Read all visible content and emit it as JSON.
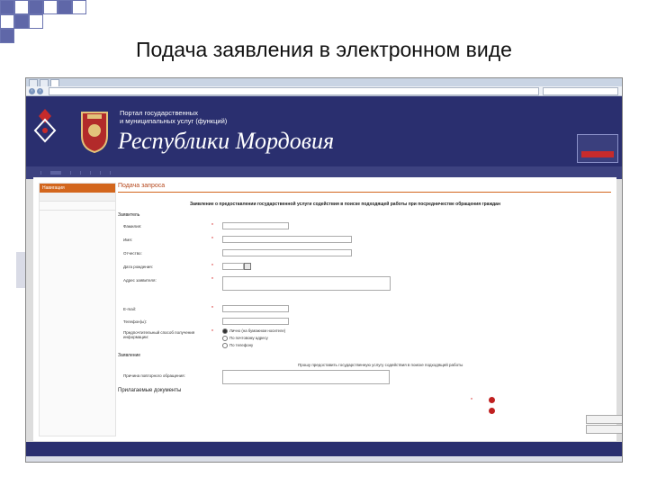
{
  "slide": {
    "title": "Подача заявления в электронном виде"
  },
  "browser": {
    "tabs": [
      "",
      "",
      ""
    ],
    "url": "",
    "search_placeholder": ""
  },
  "portal": {
    "line1": "Портал государственных",
    "line2": "и муниципальных услуг (функций)",
    "region": "Республики Мордовия",
    "toplinks": [
      "",
      "",
      "",
      ""
    ],
    "eservice_text": "",
    "login_label": ""
  },
  "nav": {
    "items": [
      "",
      "",
      "",
      "",
      "",
      "",
      "",
      ""
    ],
    "active_index": 2
  },
  "left_nav": {
    "header": "Навигация",
    "items": [
      "",
      ""
    ]
  },
  "form": {
    "request_title": "Подача запроса",
    "title": "Заявление о предоставлении государственной услуги содействия в поиске подходящей работы при посредничестве обращения граждан",
    "applicant_section": "Заявитель",
    "fields": {
      "surname": {
        "label": "Фамилия:",
        "value": ""
      },
      "name": {
        "label": "Имя:",
        "value": ""
      },
      "patronymic": {
        "label": "Отчество:",
        "value": ""
      },
      "birthdate": {
        "label": "Дата рождения:",
        "value": ""
      },
      "address": {
        "label": "Адрес заявителя:",
        "hint": ""
      },
      "email": {
        "label": "E-mail:",
        "value": ""
      },
      "phone": {
        "label": "Телефон(ы):",
        "value": ""
      },
      "info_method": {
        "label": "Предпочтительный способ получения информации:",
        "options": [
          "Лично (на бумажном носителе)",
          "По почтовому адресу",
          "По телефону"
        ],
        "selected_index": 0
      }
    },
    "statement_section": "Заявление",
    "statement_text": "Прошу предоставить государственную услугу содействия в поиске подходящей работы",
    "reason_label": "Причина повторного обращения:",
    "docs_section": "Прилагаемые документы",
    "doc_rows": [
      "",
      ""
    ],
    "side_buttons": [
      "",
      ""
    ]
  },
  "footer": {
    "left_text": "",
    "right_links": [
      "",
      "",
      ""
    ]
  },
  "status": {
    "text": ""
  },
  "colors": {
    "slide_accent": "#5f67a8",
    "header_bg": "#2a2f6f",
    "nav_bg": "#3d4280",
    "orange": "#d3661d",
    "red": "#c02020"
  }
}
